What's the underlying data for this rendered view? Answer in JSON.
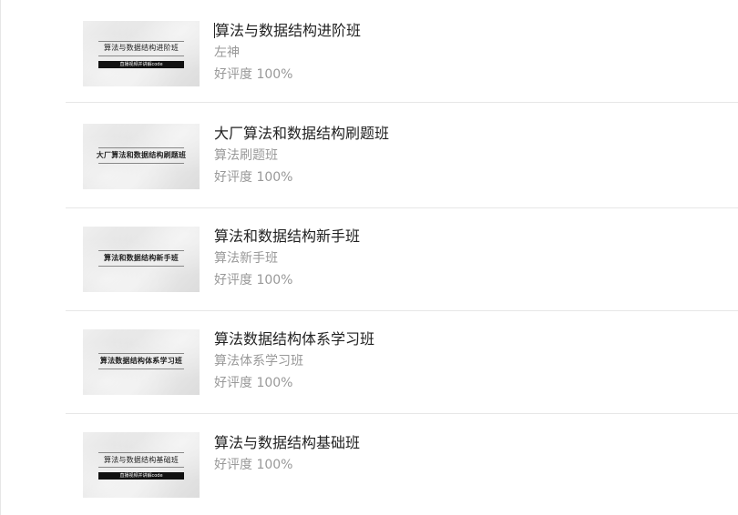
{
  "courses": [
    {
      "title": "算法与数据结构进阶班",
      "teacher": "左神",
      "rating": "好评度 100%",
      "thumb_title": "算法与数据结构进阶班",
      "thumb_band": "直播视频并讲解code"
    },
    {
      "title": "大厂算法和数据结构刷题班",
      "teacher": "算法刷题班",
      "rating": "好评度 100%",
      "thumb_title": "大厂算法和数据结构刷题班"
    },
    {
      "title": "算法和数据结构新手班",
      "teacher": "算法新手班",
      "rating": "好评度 100%",
      "thumb_title": "算法和数据结构新手班"
    },
    {
      "title": "算法数据结构体系学习班",
      "teacher": "算法体系学习班",
      "rating": "好评度 100%",
      "thumb_title": "算法数据结构体系学习班"
    },
    {
      "title": "算法与数据结构基础班",
      "rating": "好评度 100%",
      "thumb_title": "算法与数据结构基础班",
      "thumb_band": "直播视频并讲解code"
    }
  ]
}
